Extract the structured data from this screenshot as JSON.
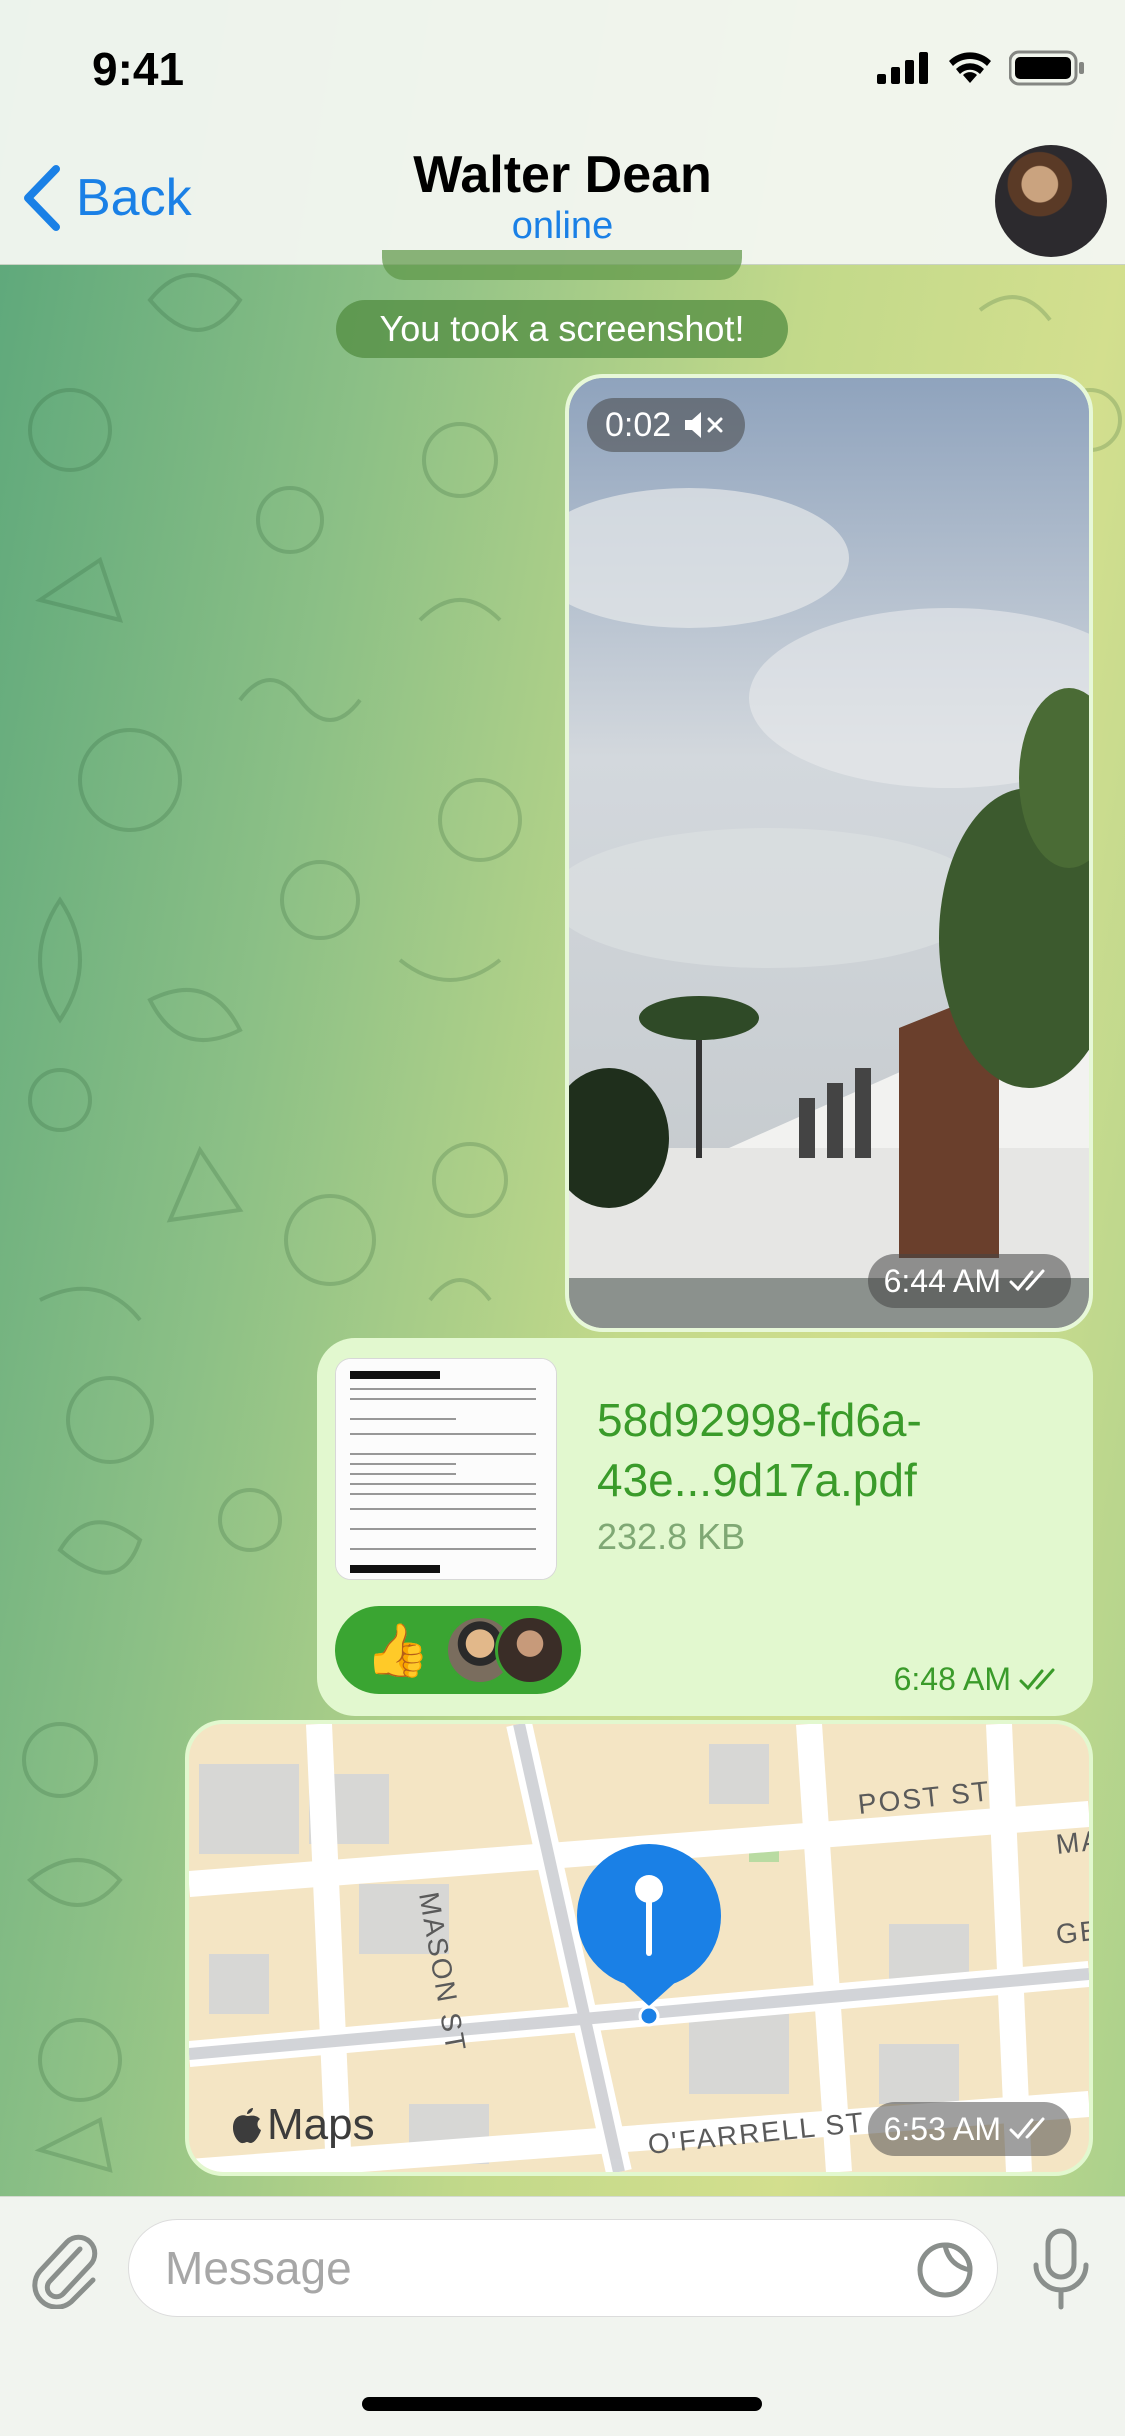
{
  "status_bar": {
    "time": "9:41"
  },
  "header": {
    "back_label": "Back",
    "title": "Walter Dean",
    "subtitle": "online"
  },
  "service_message": "You took a screenshot!",
  "video": {
    "duration": "0:02",
    "time": "6:44 AM"
  },
  "file": {
    "name": "58d92998-fd6a-43e...9d17a.pdf",
    "size": "232.8 KB",
    "time": "6:48 AM",
    "reaction_emoji": "👍"
  },
  "map": {
    "streets": [
      "POST ST",
      "MASON ST",
      "O'FARRELL ST",
      "GE",
      "MA"
    ],
    "logo_label": "Maps",
    "time": "6:53 AM"
  },
  "input": {
    "placeholder": "Message"
  },
  "colors": {
    "accent": "#1a80e6",
    "bubble_out": "#e2f8cf",
    "green_text": "#3a9b2a",
    "reaction_bg": "#3aa532"
  }
}
